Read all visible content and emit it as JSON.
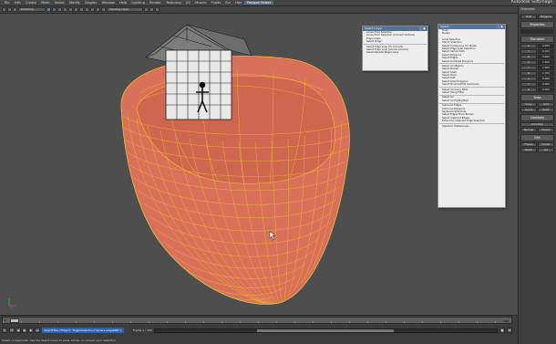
{
  "app": {
    "brand": "Autodesk Softimage"
  },
  "menubar": {
    "items": [
      "File",
      "Edit",
      "Create",
      "Mesh",
      "Select",
      "Modify",
      "Display",
      "Window",
      "Help",
      "Lighting",
      "Render",
      "Texturing",
      "UV",
      "Muscle",
      "Fluids",
      "Fur",
      "Hair",
      "nCloth"
    ],
    "highlight": "Polygon Select"
  },
  "toolbar": {
    "field1": "Modeling",
    "field2": "Shading Layer"
  },
  "menu_select_loops": {
    "title": "Select Loops",
    "items": [
      "Loops from Selection",
      "Loops from Selection (Convert Vertices)",
      "Edge Loops",
      "Select Rings",
      "",
      "Select Edge Loop (To Corners)",
      "Select Edge Loop (Across Corners)",
      "Select Parallel Edge Loops"
    ]
  },
  "menu_select": {
    "title": "Select",
    "items": [
      "Tools",
      "Modes",
      "",
      "Grow Selection",
      "Shrink Selection",
      "Select Contiguous UV Shells",
      "Select Edge Loop Selection",
      "Select Vertex Path",
      "Select Polygons",
      "Select Edges",
      "Select All Mixed Polygons",
      "",
      "Select All Objects",
      "Select Border",
      "Select Shell",
      "Select Hard",
      "Select Soft",
      "Select Shell Polygons",
      "Select Nonmanifold Geometry",
      "",
      "Select All Using Filter",
      "Select Using Filter",
      "",
      "Select All",
      "Select All Highlighted",
      "",
      "Surround Edges",
      "Surround Polygons",
      "Keyboard Shortcuts",
      "Select Edges From Border",
      "Select Adjacent Edges",
      "Extend by Adjacent Edge Selection",
      "",
      "Selection Preferences..."
    ]
  },
  "right_panel": {
    "head": "Channels",
    "tabs": [
      "Edit",
      "Polygons"
    ],
    "sections": [
      "Properties",
      "Transform",
      "Snap",
      "Constrain",
      "Edit"
    ],
    "transform_rows": [
      [
        "X",
        "0.000"
      ],
      [
        "Y",
        "0.000"
      ],
      [
        "Z",
        "0.000"
      ],
      [
        "X",
        "1.000"
      ],
      [
        "Y",
        "1.000"
      ],
      [
        "Z",
        "1.000"
      ],
      [
        "X",
        "0.000"
      ],
      [
        "Y",
        "0.000"
      ],
      [
        "Z",
        "0.000"
      ]
    ],
    "snap_buttons": [
      "Snap",
      "Grid",
      "Curve",
      "Point"
    ],
    "constrain_buttons": [
      "Constrain",
      "Normal",
      "Parent"
    ],
    "edit_buttons": [
      "Freeze",
      "Center",
      "Reset",
      "Cut"
    ]
  },
  "timeline": {
    "start": "1",
    "end": "100",
    "current_frame": "1"
  },
  "bottombar": {
    "command": "SelectFilter(\"Edge\"); ToggleSelection(\"sphere.edge[88]\");",
    "frame_info": "Frame 1 / 100",
    "anim_pref": "Auto Key",
    "help": "Select components. Use the Select menu to grow, shrink, or convert your selection."
  },
  "colors": {
    "mesh_fill": "#d9705a",
    "mesh_wire": "#f2c02e",
    "selection_blue": "#4f73a3",
    "viewport_bg": "#4e4e4e"
  }
}
